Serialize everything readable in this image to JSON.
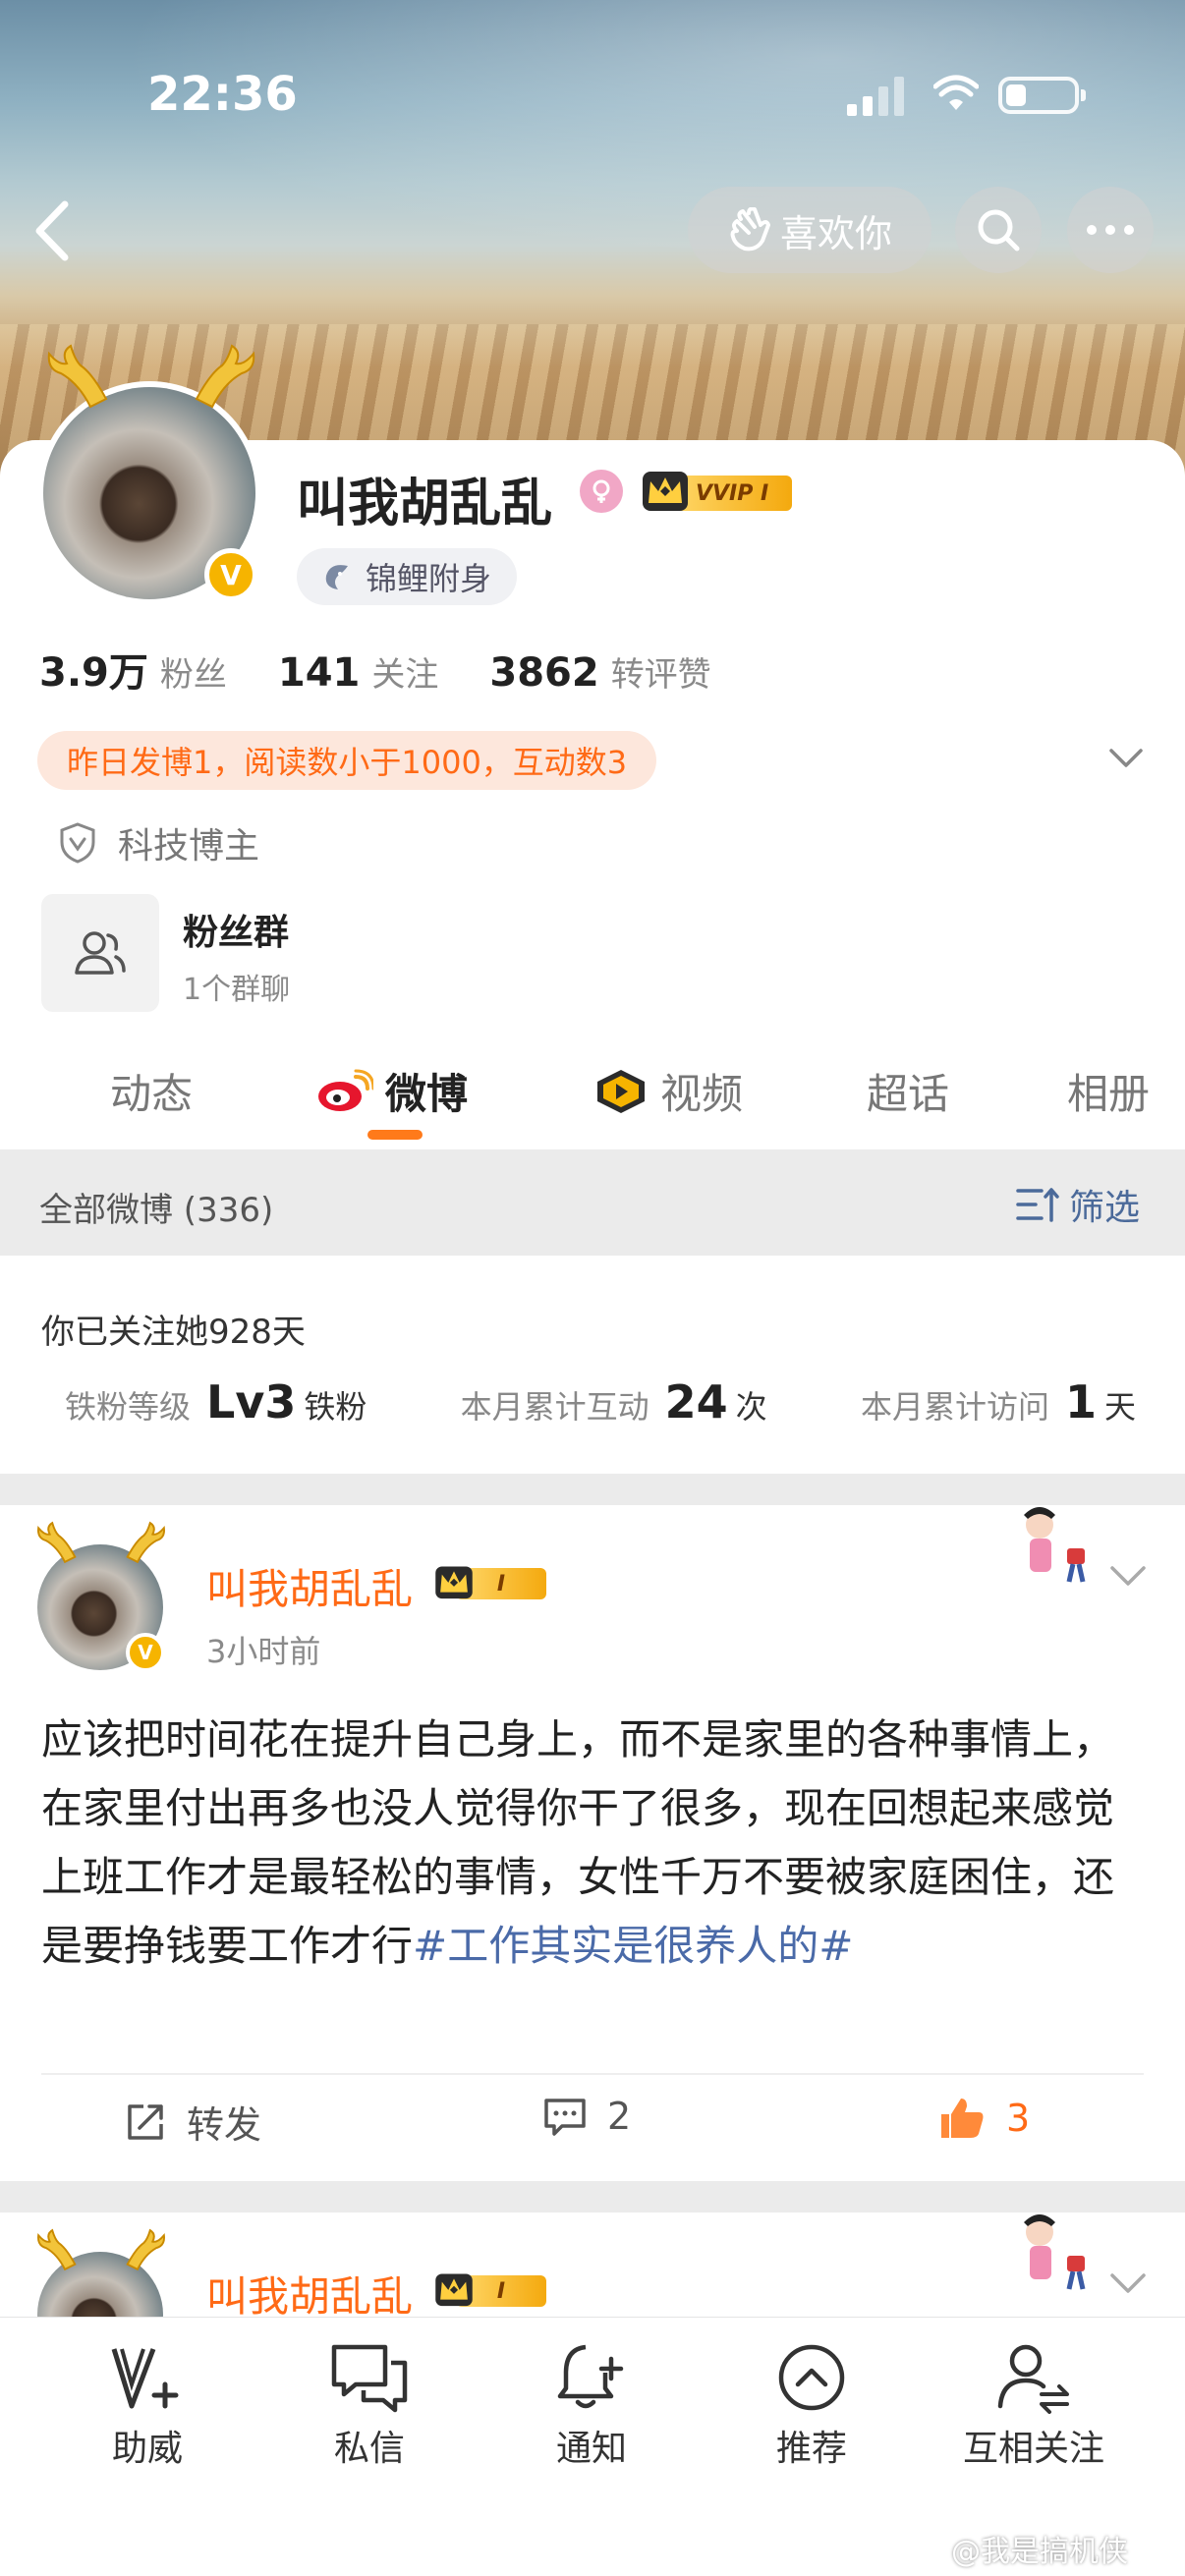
{
  "status": {
    "time": "22:36"
  },
  "header": {
    "like_label": "喜欢你"
  },
  "profile": {
    "name": "叫我胡乱乱",
    "vvip_label": "VVIP I",
    "badge_label": "锦鲤附身",
    "stats": [
      {
        "num": "3.9万",
        "label": "粉丝"
      },
      {
        "num": "141",
        "label": "关注"
      },
      {
        "num": "3862",
        "label": "转评赞"
      }
    ],
    "notice": "昨日发博1，阅读数小于1000，互动数3",
    "tag": "科技博主",
    "fan_group": {
      "title": "粉丝群",
      "subtitle": "1个群聊"
    }
  },
  "tabs": [
    {
      "label": "动态"
    },
    {
      "label": "微博"
    },
    {
      "label": "视频"
    },
    {
      "label": "超话"
    },
    {
      "label": "相册"
    }
  ],
  "feed_header": {
    "all_label": "全部微博 (336)",
    "filter_label": "筛选"
  },
  "relation": {
    "follow_days": "你已关注她928天",
    "level_label": "铁粉等级",
    "level_value": "Lv3",
    "level_unit": "铁粉",
    "interact_label": "本月累计互动",
    "interact_value": "24",
    "interact_unit": "次",
    "visit_label": "本月累计访问",
    "visit_value": "1",
    "visit_unit": "天"
  },
  "post": {
    "author": "叫我胡乱乱",
    "member_label": "I",
    "time": "3小时前",
    "text": "应该把时间花在提升自己身上，而不是家里的各种事情上，在家里付出再多也没人觉得你干了很多，现在回想起来感觉上班工作才是最轻松的事情，女性千万不要被家庭困住，还是要挣钱要工作才行",
    "hashtag": "#工作其实是很养人的#",
    "repost_label": "转发",
    "comments": "2",
    "likes": "3"
  },
  "post2": {
    "author": "叫我胡乱乱",
    "member_label": "I"
  },
  "bottom_nav": [
    {
      "label": "助威"
    },
    {
      "label": "私信"
    },
    {
      "label": "通知"
    },
    {
      "label": "推荐"
    },
    {
      "label": "互相关注"
    }
  ],
  "watermark": "@我是搞机侠",
  "colors": {
    "accent": "#ff6a16",
    "link": "#4a6aa8",
    "gold": "#f6b400"
  }
}
